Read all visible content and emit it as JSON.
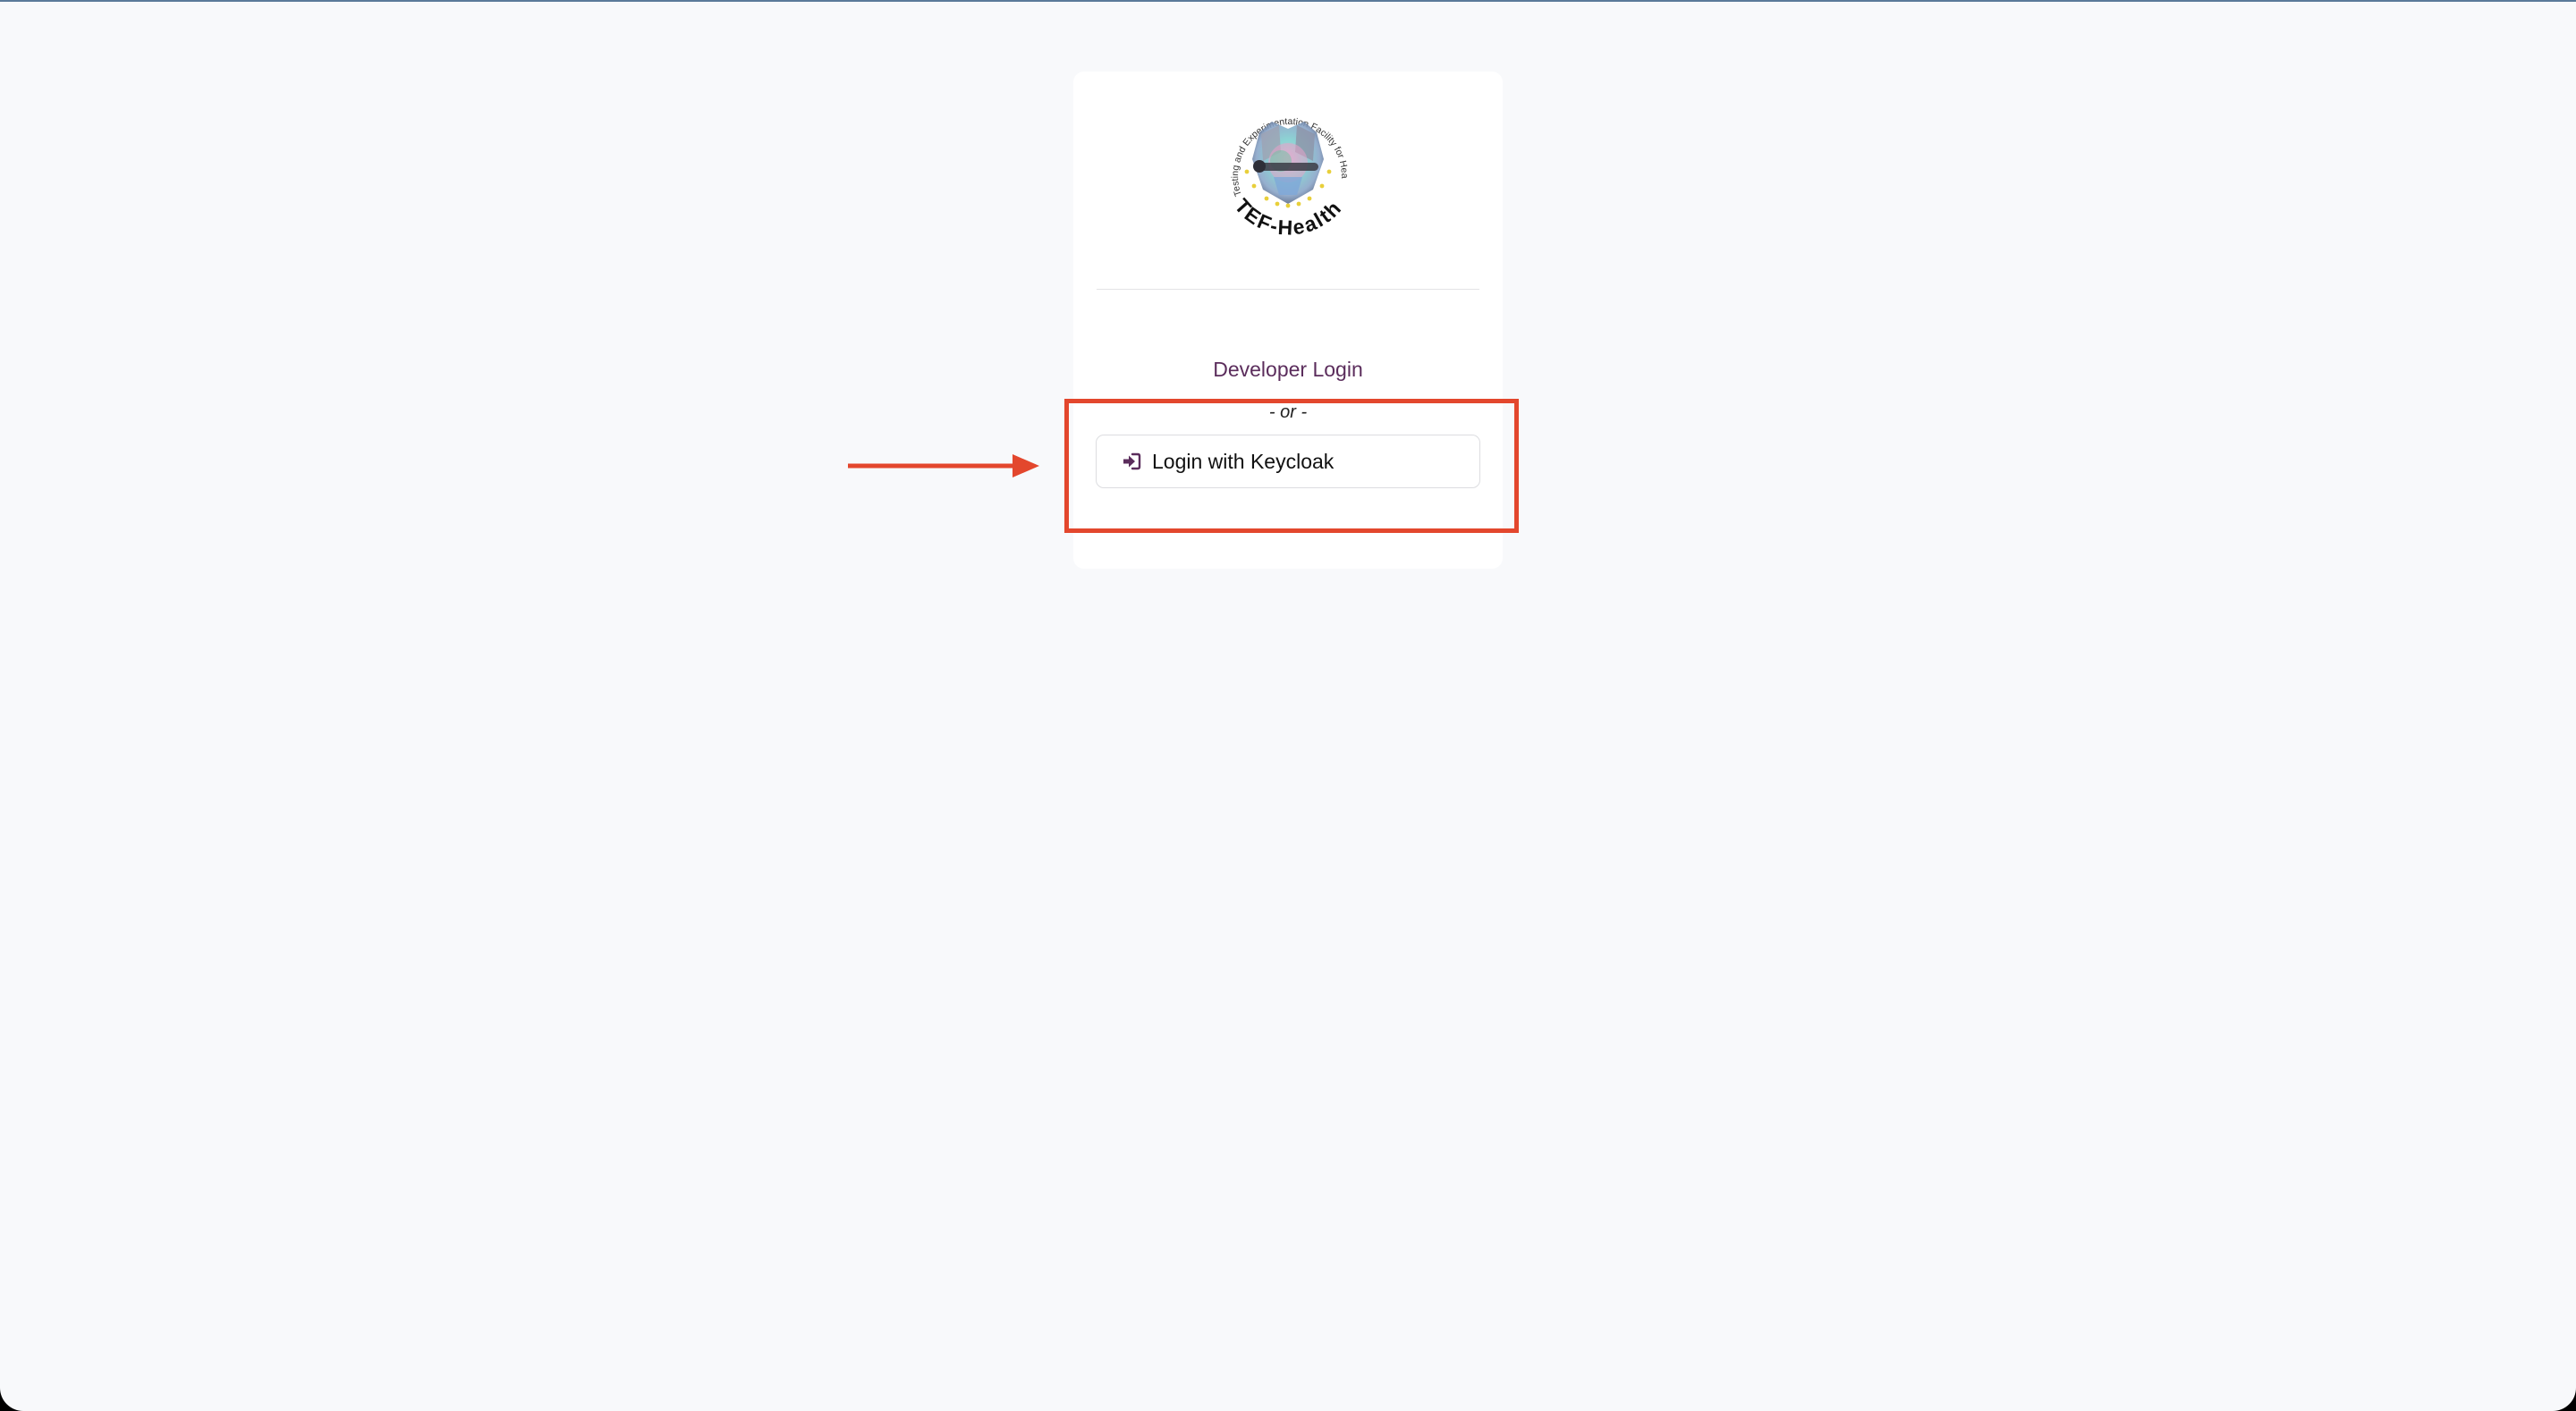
{
  "logo": {
    "ring_text": "Testing and Experimentation Facility for Health AI and Robotics",
    "brand_text": "TEF-Health"
  },
  "login": {
    "developer_login_label": "Developer Login",
    "separator_text": "- or -",
    "keycloak_button_label": "Login with Keycloak",
    "keycloak_icon": "sign-in-icon"
  },
  "annotation": {
    "highlight_color": "#e3472d"
  },
  "colors": {
    "accent": "#5b2d5c",
    "background": "#f8f9fb",
    "card": "#ffffff"
  }
}
